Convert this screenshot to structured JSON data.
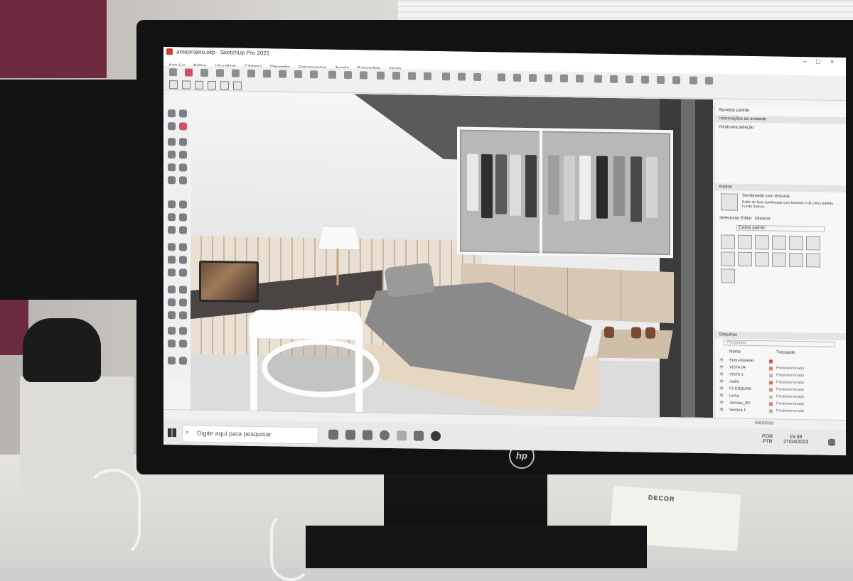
{
  "sketchup": {
    "window_title": "anteprojeto.skp - SketchUp Pro 2021",
    "menu": [
      "Arquivo",
      "Editar",
      "Visualizar",
      "Câmera",
      "Desenho",
      "Ferramentas",
      "Janela",
      "Extensões",
      "Ajuda"
    ],
    "tray": {
      "title": "Bandeja padrão",
      "entity_info_header": "Informações da entidade",
      "entity_info_value": "Nenhuma seleção",
      "styles_header": "Estilos",
      "style_name": "Sombreado com texturas",
      "style_desc": "Estilo de face sombreado com texturas e de cores padrão. Fundo branco.",
      "style_tabs": [
        "Selecionar",
        "Editar",
        "Misturar"
      ],
      "style_collection": "Estilos padrão",
      "tags_header": "Etiquetas",
      "tags_search_placeholder": "Pesquisar",
      "tags_columns": [
        "Nome",
        "Tracejado"
      ],
      "tags": [
        {
          "name": "Sem etiquetas",
          "dash": "",
          "color": "#d9534f"
        },
        {
          "name": "VISTA 04",
          "dash": "Predeterminado",
          "color": "#e07b6a"
        },
        {
          "name": "VISTA 1",
          "dash": "Predeterminado",
          "color": "#b8b8b8"
        },
        {
          "name": "cadre",
          "dash": "Predeterminado",
          "color": "#d46a5a"
        },
        {
          "name": "F1 ESQUAD",
          "dash": "Predeterminado",
          "color": "#e28a72"
        },
        {
          "name": "Linha",
          "dash": "Predeterminado",
          "color": "#c2c2c2"
        },
        {
          "name": "Janelas_3D",
          "dash": "Predeterminado",
          "color": "#d47d6b"
        },
        {
          "name": "Vectura 1",
          "dash": "Predeterminado",
          "color": "#b5b5b5"
        }
      ]
    },
    "status_measure_label": "Medidas"
  },
  "taskbar": {
    "search_placeholder": "Digite aqui para pesquisar",
    "lang": "POR",
    "kbd": "PTB",
    "time": "15:39",
    "date": "27/04/2023"
  },
  "desk": {
    "card_text": "DECOR"
  },
  "colors": {
    "screen_bg": "#f3f3f3",
    "bezel": "#121212"
  },
  "icons": [
    "sketchup-app-icon",
    "select-icon",
    "eraser-icon",
    "pencil-icon",
    "orbit-icon",
    "windows-start-icon",
    "search-icon",
    "spotify-icon",
    "chrome-icon"
  ]
}
